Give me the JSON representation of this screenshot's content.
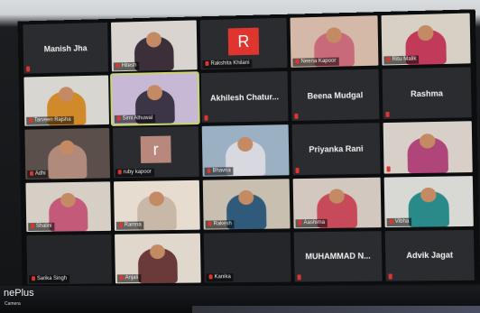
{
  "tiles": [
    {
      "type": "name",
      "name": "Manish Jha",
      "label": "",
      "muted": true
    },
    {
      "type": "video",
      "name": "",
      "label": "Hitesh",
      "muted": true,
      "bg": "#d9d4cf",
      "shirt": "#3b2f3a"
    },
    {
      "type": "avatar",
      "name": "",
      "letter": "R",
      "avatar_color": "#e0352f",
      "label": "Rakshita Khilani",
      "muted": true
    },
    {
      "type": "video",
      "name": "",
      "label": "Neena Kapoor",
      "muted": true,
      "bg": "#d4b8a8",
      "shirt": "#c96a7a"
    },
    {
      "type": "video",
      "name": "",
      "label": "Ritu Malik",
      "muted": true,
      "bg": "#d8d0c4",
      "shirt": "#c13a5a"
    },
    {
      "type": "video",
      "name": "",
      "label": "Tarveen Rajsha",
      "muted": true,
      "bg": "#d8d6d0",
      "shirt": "#d08a2a"
    },
    {
      "type": "video",
      "name": "",
      "label": "Simi Alhuwal",
      "muted": true,
      "bg": "#c7b9d6",
      "shirt": "#3c3548",
      "active": true
    },
    {
      "type": "name",
      "name": "Akhilesh  Chatur...",
      "label": "",
      "muted": true
    },
    {
      "type": "name",
      "name": "Beena Mudgal",
      "label": "",
      "muted": true
    },
    {
      "type": "name",
      "name": "Rashma",
      "label": "",
      "muted": true
    },
    {
      "type": "video",
      "name": "",
      "label": "Adhi",
      "muted": true,
      "bg": "#5a4f4a",
      "shirt": "#b08a7a"
    },
    {
      "type": "avatar",
      "name": "",
      "letter": "r",
      "avatar_color": "#b9887c",
      "label": "ruby kapoor",
      "muted": true
    },
    {
      "type": "video",
      "name": "",
      "label": "Bhavna",
      "muted": true,
      "bg": "#9bb0c2",
      "shirt": "#d8d8e0"
    },
    {
      "type": "name",
      "name": "Priyanka Rani",
      "label": "",
      "muted": true
    },
    {
      "type": "video",
      "name": "",
      "label": "",
      "muted": true,
      "bg": "#d8d0c8",
      "shirt": "#b0457a"
    },
    {
      "type": "video",
      "name": "",
      "label": "Shalini",
      "muted": true,
      "bg": "#d6cfc6",
      "shirt": "#c45a7a"
    },
    {
      "type": "video",
      "name": "",
      "label": "Ramna",
      "muted": true,
      "bg": "#e6dcd0",
      "shirt": "#c8b8a8"
    },
    {
      "type": "video",
      "name": "",
      "label": "Rakesh",
      "muted": true,
      "bg": "#c8bfb0",
      "shirt": "#2f5a7a"
    },
    {
      "type": "video",
      "name": "",
      "label": "Aashima",
      "muted": true,
      "bg": "#d2c8c0",
      "shirt": "#c64a5a"
    },
    {
      "type": "video",
      "name": "",
      "label": "Vibha",
      "muted": true,
      "bg": "#d8d8d4",
      "shirt": "#2a8a8a"
    },
    {
      "type": "video",
      "name": "",
      "label": "Sarika Singh",
      "muted": true,
      "bg": "#24262a",
      "shirt": "#24262a",
      "empty": true
    },
    {
      "type": "video",
      "name": "",
      "label": "Anjali",
      "muted": true,
      "bg": "#e0d8cc",
      "shirt": "#6a3a3a"
    },
    {
      "type": "video",
      "name": "",
      "label": "Kanika",
      "muted": true,
      "bg": "#24262a",
      "shirt": "#24262a",
      "empty": true
    },
    {
      "type": "name",
      "name": "MUHAMMAD  N...",
      "label": "",
      "muted": true
    },
    {
      "type": "name",
      "name": "Advik Jagat",
      "label": "",
      "muted": true
    }
  ],
  "watermark": {
    "brand": "nePlus",
    "sub": "Camera"
  }
}
